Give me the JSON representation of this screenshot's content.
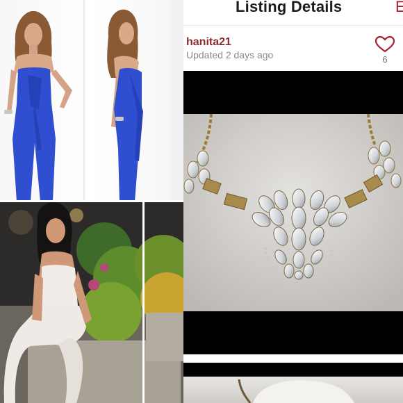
{
  "header": {
    "title": "Listing Details",
    "edit_label": "E"
  },
  "seller": {
    "username": "hanita21",
    "updated": "Updated 2 days ago"
  },
  "likes": {
    "count": "6"
  },
  "colors": {
    "accent": "#a3242f",
    "username": "#8b2b2b",
    "jumpsuit_blue": "#2f4fd0"
  },
  "icons": {
    "like": "heart-outline-icon"
  }
}
